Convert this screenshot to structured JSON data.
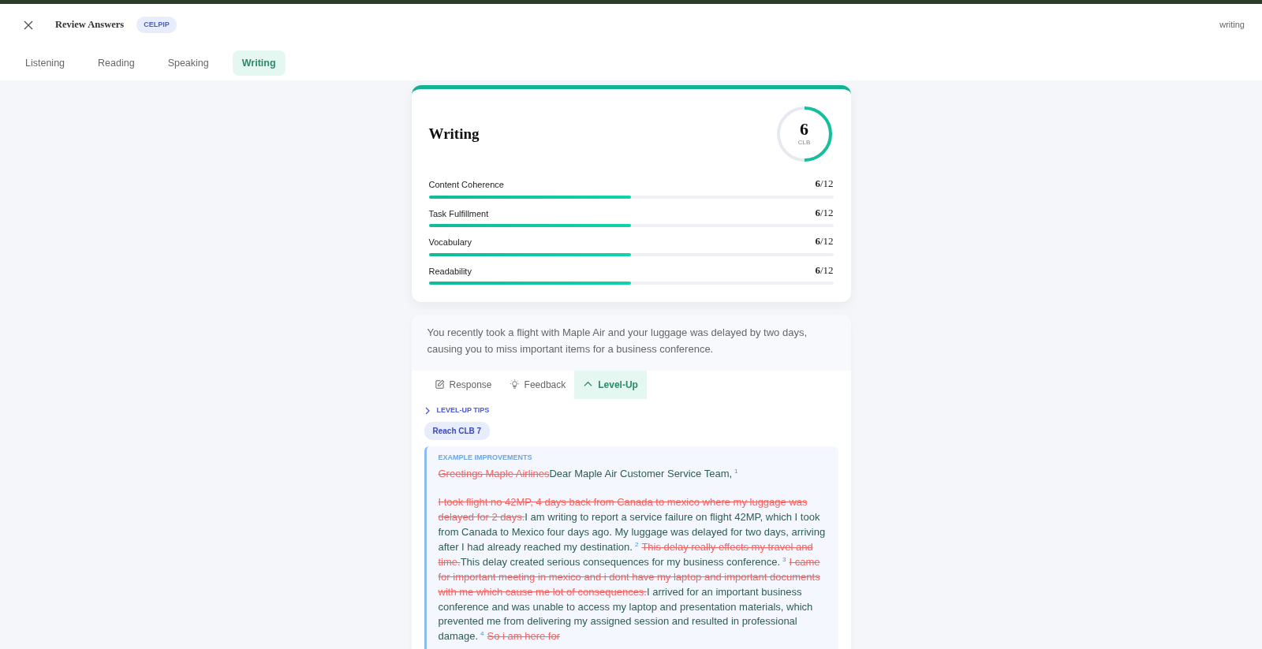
{
  "header": {
    "title": "Review Answers",
    "badge": "CELPIP",
    "right_label": "writing"
  },
  "tabs": [
    {
      "label": "Listening",
      "selected": false
    },
    {
      "label": "Reading",
      "selected": false
    },
    {
      "label": "Speaking",
      "selected": false
    },
    {
      "label": "Writing",
      "selected": true
    }
  ],
  "score_card": {
    "title": "Writing",
    "score": "6",
    "score_unit": "CLB",
    "level": 0.5,
    "criteria": [
      {
        "name": "Content Coherence",
        "score": "6",
        "max": "/12",
        "level": 0.5
      },
      {
        "name": "Task Fulfillment",
        "score": "6",
        "max": "/12",
        "level": 0.5
      },
      {
        "name": "Vocabulary",
        "score": "6",
        "max": "/12",
        "level": 0.5
      },
      {
        "name": "Readability",
        "score": "6",
        "max": "/12",
        "level": 0.5
      }
    ]
  },
  "task": {
    "prompt": "You recently took a flight with Maple Air and your luggage was delayed by two days, causing you to miss important items for a business conference.",
    "tabs": [
      {
        "label": "Response",
        "kind": "pencil",
        "selected": false
      },
      {
        "label": "Feedback",
        "kind": "bulb",
        "selected": false
      },
      {
        "label": "Level-Up",
        "kind": "chevron",
        "selected": true
      }
    ],
    "tips_toggle": {
      "label": "LEVEL-UP TIPS",
      "expanded": false
    },
    "target_badge": "Reach CLB 7",
    "improvements": {
      "heading": "EXAMPLE IMPROVEMENTS",
      "paragraphs": [
        [
          {
            "kind": "deleted",
            "text": "Greetings Maple Airlines"
          },
          {
            "kind": "added",
            "text": "Dear Maple Air Customer Service Team,"
          },
          {
            "kind": "ref",
            "text": "1"
          }
        ],
        [
          {
            "kind": "deleted",
            "text": "I took flight no 42MP, 4 days back from Canada to mexico where my luggage was delayed for 2 days."
          },
          {
            "kind": "added",
            "text": "I am writing to report a service failure on flight 42MP, which I took from Canada to Mexico four days ago. My luggage was delayed for two days, arriving after I had already reached my destination."
          },
          {
            "kind": "ref",
            "text": "2"
          },
          {
            "kind": "deleted",
            "text": "This delay really effects my travel and time."
          },
          {
            "kind": "added",
            "text": "This delay created serious consequences for my business conference."
          },
          {
            "kind": "ref",
            "text": "3"
          },
          {
            "kind": "deleted",
            "text": "I came for important meeting in mexico and i dont have my laptop and important documents with me which cause me lot of consequences."
          },
          {
            "kind": "added",
            "text": "I arrived for an important business conference and was unable to access my laptop and presentation materials, which prevented me from delivering my assigned session and resulted in professional damage."
          },
          {
            "kind": "ref",
            "text": "4"
          },
          {
            "kind": "deleted",
            "text": "So i am here for"
          }
        ]
      ]
    }
  }
}
